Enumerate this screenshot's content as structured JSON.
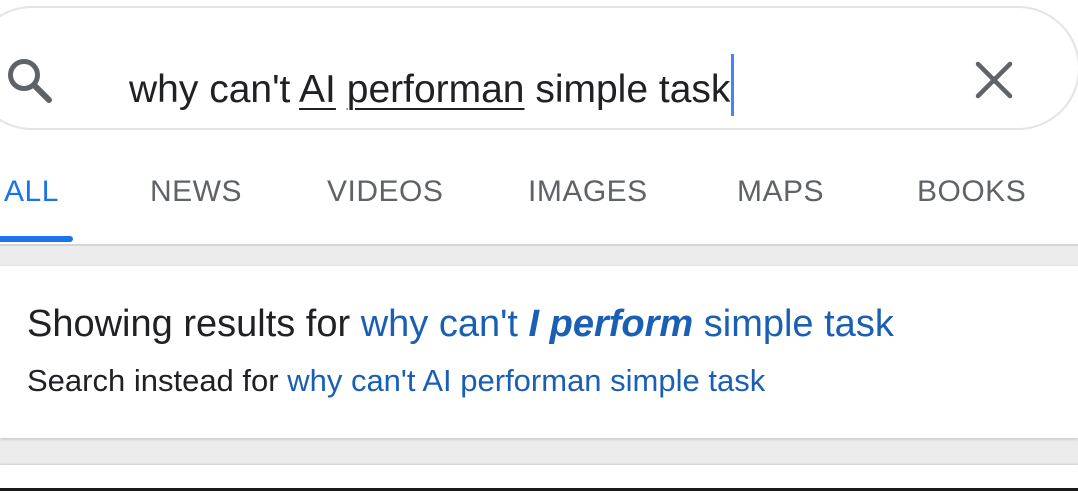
{
  "search": {
    "query_parts": {
      "prefix": "why can't ",
      "word_ai": "AI",
      "space": " ",
      "word_performan": "performan",
      "suffix": " simple task"
    },
    "search_icon": "search-icon",
    "clear_icon": "close-icon"
  },
  "tabs": [
    {
      "label": "ALL",
      "active": true
    },
    {
      "label": "NEWS",
      "active": false
    },
    {
      "label": "VIDEOS",
      "active": false
    },
    {
      "label": "IMAGES",
      "active": false
    },
    {
      "label": "MAPS",
      "active": false
    },
    {
      "label": "BOOKS",
      "active": false
    }
  ],
  "spelling": {
    "showing_prefix": "Showing results for ",
    "corrected_part1": "why can't ",
    "corrected_emph": "I perform",
    "corrected_part2": " simple task",
    "instead_prefix": "Search instead for ",
    "original_query": "why can't AI performan simple task"
  },
  "colors": {
    "accent": "#1a73e8",
    "link": "#1a5fb4",
    "caret": "#4285f4",
    "text": "#202124",
    "muted": "#5f6368"
  }
}
